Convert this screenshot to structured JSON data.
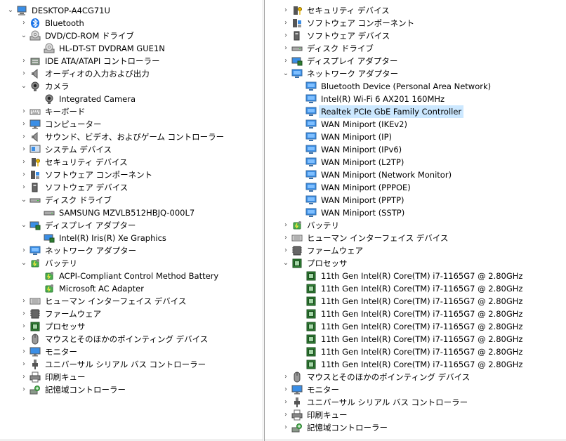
{
  "left": {
    "root": {
      "label": "DESKTOP-A4CG71U",
      "icon": "computer-icon"
    },
    "items": [
      {
        "level": 1,
        "exp": ">",
        "label": "Bluetooth",
        "icon": "bluetooth-icon"
      },
      {
        "level": 1,
        "exp": "v",
        "label": "DVD/CD-ROM ドライブ",
        "icon": "dvd-drive-icon"
      },
      {
        "level": 2,
        "exp": "",
        "label": "HL-DT-ST DVDRAM GUE1N",
        "icon": "dvd-drive-icon"
      },
      {
        "level": 1,
        "exp": ">",
        "label": "IDE ATA/ATAPI コントローラー",
        "icon": "ide-controller-icon"
      },
      {
        "level": 1,
        "exp": ">",
        "label": "オーディオの入力および出力",
        "icon": "speaker-icon"
      },
      {
        "level": 1,
        "exp": "v",
        "label": "カメラ",
        "icon": "camera-icon"
      },
      {
        "level": 2,
        "exp": "",
        "label": "Integrated Camera",
        "icon": "camera-icon"
      },
      {
        "level": 1,
        "exp": ">",
        "label": "キーボード",
        "icon": "keyboard-icon"
      },
      {
        "level": 1,
        "exp": ">",
        "label": "コンピューター",
        "icon": "monitor-icon"
      },
      {
        "level": 1,
        "exp": ">",
        "label": "サウンド、ビデオ、およびゲーム コントローラー",
        "icon": "speaker-icon"
      },
      {
        "level": 1,
        "exp": ">",
        "label": "システム デバイス",
        "icon": "system-device-icon"
      },
      {
        "level": 1,
        "exp": ">",
        "label": "セキュリティ デバイス",
        "icon": "security-device-icon"
      },
      {
        "level": 1,
        "exp": ">",
        "label": "ソフトウェア コンポーネント",
        "icon": "software-component-icon"
      },
      {
        "level": 1,
        "exp": ">",
        "label": "ソフトウェア デバイス",
        "icon": "software-device-icon"
      },
      {
        "level": 1,
        "exp": "v",
        "label": "ディスク ドライブ",
        "icon": "disk-drive-icon"
      },
      {
        "level": 2,
        "exp": "",
        "label": "SAMSUNG MZVLB512HBJQ-000L7",
        "icon": "disk-drive-icon"
      },
      {
        "level": 1,
        "exp": "v",
        "label": "ディスプレイ アダプター",
        "icon": "display-adapter-icon"
      },
      {
        "level": 2,
        "exp": "",
        "label": "Intel(R) Iris(R) Xe Graphics",
        "icon": "display-adapter-icon"
      },
      {
        "level": 1,
        "exp": ">",
        "label": "ネットワーク アダプター",
        "icon": "network-adapter-icon"
      },
      {
        "level": 1,
        "exp": "v",
        "label": "バッテリ",
        "icon": "battery-icon"
      },
      {
        "level": 2,
        "exp": "",
        "label": "ACPI-Compliant Control Method Battery",
        "icon": "battery-icon"
      },
      {
        "level": 2,
        "exp": "",
        "label": "Microsoft AC Adapter",
        "icon": "battery-icon"
      },
      {
        "level": 1,
        "exp": ">",
        "label": "ヒューマン インターフェイス デバイス",
        "icon": "hid-icon"
      },
      {
        "level": 1,
        "exp": ">",
        "label": "ファームウェア",
        "icon": "firmware-icon"
      },
      {
        "level": 1,
        "exp": ">",
        "label": "プロセッサ",
        "icon": "processor-icon"
      },
      {
        "level": 1,
        "exp": ">",
        "label": "マウスとそのほかのポインティング デバイス",
        "icon": "mouse-icon"
      },
      {
        "level": 1,
        "exp": ">",
        "label": "モニター",
        "icon": "monitor-icon"
      },
      {
        "level": 1,
        "exp": ">",
        "label": "ユニバーサル シリアル バス コントローラー",
        "icon": "usb-icon"
      },
      {
        "level": 1,
        "exp": ">",
        "label": "印刷キュー",
        "icon": "printer-icon"
      },
      {
        "level": 1,
        "exp": ">",
        "label": "記憶域コントローラー",
        "icon": "storage-controller-icon"
      }
    ]
  },
  "right": {
    "items": [
      {
        "level": 1,
        "exp": ">",
        "label": "セキュリティ デバイス",
        "icon": "security-device-icon"
      },
      {
        "level": 1,
        "exp": ">",
        "label": "ソフトウェア コンポーネント",
        "icon": "software-component-icon"
      },
      {
        "level": 1,
        "exp": ">",
        "label": "ソフトウェア デバイス",
        "icon": "software-device-icon"
      },
      {
        "level": 1,
        "exp": ">",
        "label": "ディスク ドライブ",
        "icon": "disk-drive-icon"
      },
      {
        "level": 1,
        "exp": ">",
        "label": "ディスプレイ アダプター",
        "icon": "display-adapter-icon"
      },
      {
        "level": 1,
        "exp": "v",
        "label": "ネットワーク アダプター",
        "icon": "network-adapter-icon"
      },
      {
        "level": 2,
        "exp": "",
        "label": "Bluetooth Device (Personal Area Network)",
        "icon": "network-adapter-icon"
      },
      {
        "level": 2,
        "exp": "",
        "label": "Intel(R) Wi-Fi 6 AX201 160MHz",
        "icon": "network-adapter-icon"
      },
      {
        "level": 2,
        "exp": "",
        "label": "Realtek PCIe GbE Family Controller",
        "icon": "network-adapter-icon",
        "selected": true
      },
      {
        "level": 2,
        "exp": "",
        "label": "WAN Miniport (IKEv2)",
        "icon": "network-adapter-icon"
      },
      {
        "level": 2,
        "exp": "",
        "label": "WAN Miniport (IP)",
        "icon": "network-adapter-icon"
      },
      {
        "level": 2,
        "exp": "",
        "label": "WAN Miniport (IPv6)",
        "icon": "network-adapter-icon"
      },
      {
        "level": 2,
        "exp": "",
        "label": "WAN Miniport (L2TP)",
        "icon": "network-adapter-icon"
      },
      {
        "level": 2,
        "exp": "",
        "label": "WAN Miniport (Network Monitor)",
        "icon": "network-adapter-icon"
      },
      {
        "level": 2,
        "exp": "",
        "label": "WAN Miniport (PPPOE)",
        "icon": "network-adapter-icon"
      },
      {
        "level": 2,
        "exp": "",
        "label": "WAN Miniport (PPTP)",
        "icon": "network-adapter-icon"
      },
      {
        "level": 2,
        "exp": "",
        "label": "WAN Miniport (SSTP)",
        "icon": "network-adapter-icon"
      },
      {
        "level": 1,
        "exp": ">",
        "label": "バッテリ",
        "icon": "battery-icon"
      },
      {
        "level": 1,
        "exp": ">",
        "label": "ヒューマン インターフェイス デバイス",
        "icon": "hid-icon"
      },
      {
        "level": 1,
        "exp": ">",
        "label": "ファームウェア",
        "icon": "firmware-icon"
      },
      {
        "level": 1,
        "exp": "v",
        "label": "プロセッサ",
        "icon": "processor-icon"
      },
      {
        "level": 2,
        "exp": "",
        "label": "11th Gen Intel(R) Core(TM) i7-1165G7 @ 2.80GHz",
        "icon": "processor-icon"
      },
      {
        "level": 2,
        "exp": "",
        "label": "11th Gen Intel(R) Core(TM) i7-1165G7 @ 2.80GHz",
        "icon": "processor-icon"
      },
      {
        "level": 2,
        "exp": "",
        "label": "11th Gen Intel(R) Core(TM) i7-1165G7 @ 2.80GHz",
        "icon": "processor-icon"
      },
      {
        "level": 2,
        "exp": "",
        "label": "11th Gen Intel(R) Core(TM) i7-1165G7 @ 2.80GHz",
        "icon": "processor-icon"
      },
      {
        "level": 2,
        "exp": "",
        "label": "11th Gen Intel(R) Core(TM) i7-1165G7 @ 2.80GHz",
        "icon": "processor-icon"
      },
      {
        "level": 2,
        "exp": "",
        "label": "11th Gen Intel(R) Core(TM) i7-1165G7 @ 2.80GHz",
        "icon": "processor-icon"
      },
      {
        "level": 2,
        "exp": "",
        "label": "11th Gen Intel(R) Core(TM) i7-1165G7 @ 2.80GHz",
        "icon": "processor-icon"
      },
      {
        "level": 2,
        "exp": "",
        "label": "11th Gen Intel(R) Core(TM) i7-1165G7 @ 2.80GHz",
        "icon": "processor-icon"
      },
      {
        "level": 1,
        "exp": ">",
        "label": "マウスとそのほかのポインティング デバイス",
        "icon": "mouse-icon"
      },
      {
        "level": 1,
        "exp": ">",
        "label": "モニター",
        "icon": "monitor-icon"
      },
      {
        "level": 1,
        "exp": ">",
        "label": "ユニバーサル シリアル バス コントローラー",
        "icon": "usb-icon"
      },
      {
        "level": 1,
        "exp": ">",
        "label": "印刷キュー",
        "icon": "printer-icon"
      },
      {
        "level": 1,
        "exp": ">",
        "label": "記憶域コントローラー",
        "icon": "storage-controller-icon"
      }
    ]
  },
  "colors": {
    "selection": "#cce8ff",
    "accent": "#1a73c8"
  }
}
